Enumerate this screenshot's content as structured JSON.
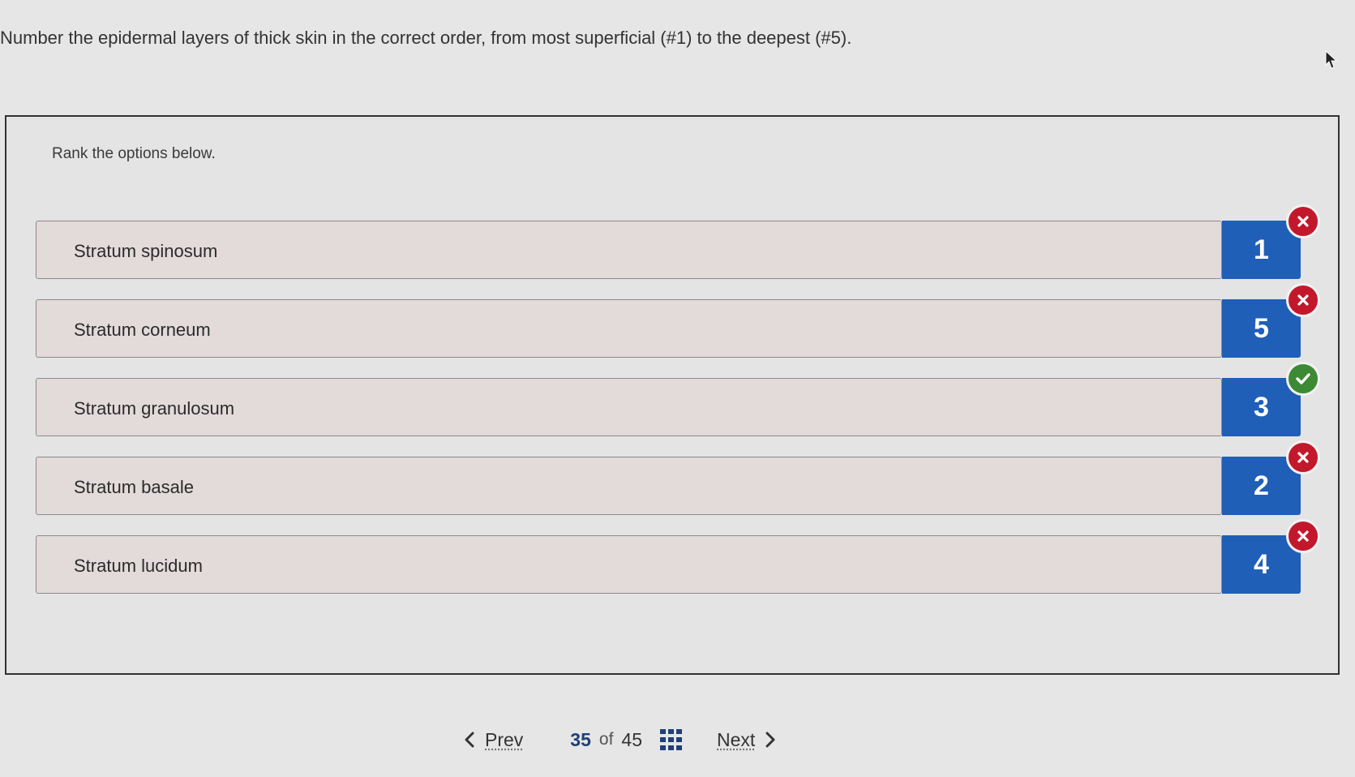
{
  "question": "Number the epidermal layers of thick skin in the correct order, from most superficial (#1) to the deepest (#5).",
  "instruction": "Rank the options below.",
  "options": [
    {
      "label": "Stratum spinosum",
      "rank": "1",
      "status": "incorrect"
    },
    {
      "label": "Stratum corneum",
      "rank": "5",
      "status": "incorrect"
    },
    {
      "label": "Stratum granulosum",
      "rank": "3",
      "status": "correct"
    },
    {
      "label": "Stratum basale",
      "rank": "2",
      "status": "incorrect"
    },
    {
      "label": "Stratum lucidum",
      "rank": "4",
      "status": "incorrect"
    }
  ],
  "navigation": {
    "prev_label": "Prev",
    "current_page": "35",
    "of_label": "of",
    "total_pages": "45",
    "next_label": "Next",
    "grid_icon": "grid-icon"
  },
  "colors": {
    "rank_badge": "#1f5fb8",
    "incorrect": "#c3182c",
    "correct": "#3d8a34",
    "page_number": "#1f3f77"
  }
}
